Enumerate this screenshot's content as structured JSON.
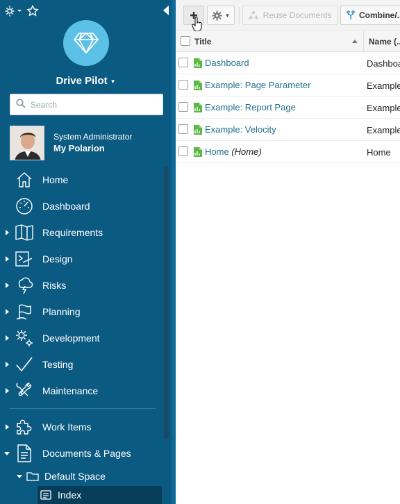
{
  "colors": {
    "sidebar": "#0b5a82",
    "logo_circle": "#5bc1e6",
    "link": "#1f6f8b",
    "page_icon": "#5bb842"
  },
  "sidebar": {
    "project_name": "Drive Pilot",
    "search_placeholder": "Search",
    "user": {
      "role": "System Administrator",
      "link": "My Polarion"
    },
    "nav": [
      {
        "label": "Home",
        "icon": "home-icon",
        "expandable": false
      },
      {
        "label": "Dashboard",
        "icon": "dashboard-gauge-icon",
        "expandable": false
      },
      {
        "label": "Requirements",
        "icon": "requirements-map-icon",
        "expandable": true
      },
      {
        "label": "Design",
        "icon": "design-icon",
        "expandable": true
      },
      {
        "label": "Risks",
        "icon": "risks-lightning-icon",
        "expandable": true
      },
      {
        "label": "Planning",
        "icon": "planning-flag-icon",
        "expandable": true
      },
      {
        "label": "Development",
        "icon": "development-gears-icon",
        "expandable": true
      },
      {
        "label": "Testing",
        "icon": "testing-check-icon",
        "expandable": true
      },
      {
        "label": "Maintenance",
        "icon": "maintenance-tools-icon",
        "expandable": true
      },
      {
        "label": "Work Items",
        "icon": "work-items-puzzle-icon",
        "expandable": true
      },
      {
        "label": "Documents & Pages",
        "icon": "documents-pages-icon",
        "expandable": true
      }
    ],
    "subtree": {
      "space": "Default Space",
      "selected": "Index"
    }
  },
  "toolbar": {
    "reuse_label": "Reuse Documents",
    "combine_label": "Combine/..."
  },
  "grid": {
    "columns": [
      "Title",
      "Name (..."
    ],
    "rows": [
      {
        "title": "Dashboard",
        "suffix": "",
        "name": "Dashboa..."
      },
      {
        "title": "Example: Page Parameter",
        "suffix": "",
        "name": "Example..."
      },
      {
        "title": "Example: Report Page",
        "suffix": "",
        "name": "Example..."
      },
      {
        "title": "Example: Velocity",
        "suffix": "",
        "name": "Example..."
      },
      {
        "title": "Home",
        "suffix": "(Home)",
        "name": "Home"
      }
    ]
  }
}
